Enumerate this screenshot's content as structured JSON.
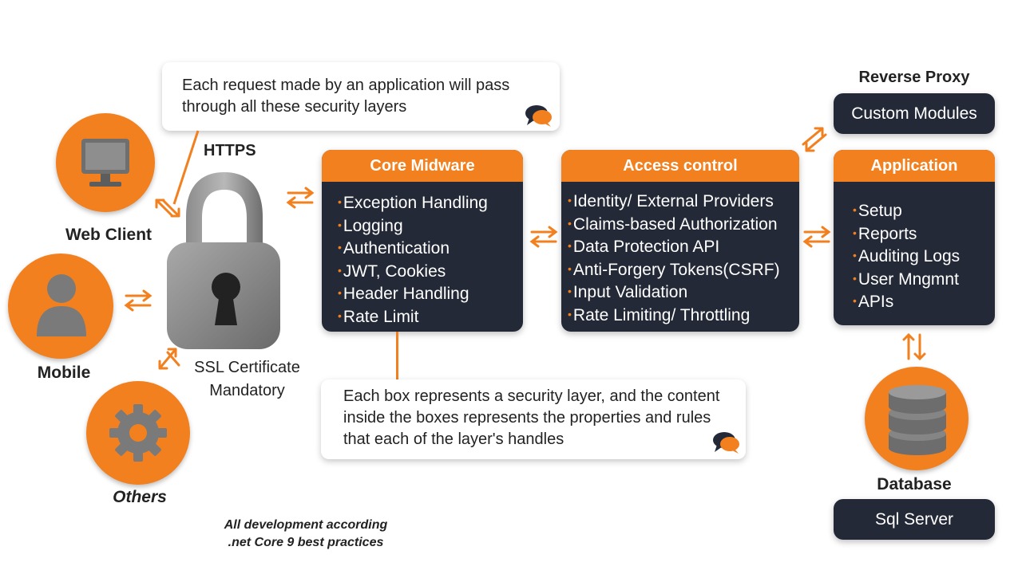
{
  "callout_top": "Each request made by an application will pass through all these security layers",
  "callout_bottom": "Each box represents a security layer, and the content inside the boxes represents the properties and rules that each of the layer's handles",
  "https_label": "HTTPS",
  "ssl_label": "SSL Certificate Mandatory",
  "clients": [
    {
      "label": "Web Client",
      "icon": "monitor-icon"
    },
    {
      "label": "Mobile",
      "icon": "user-icon"
    },
    {
      "label": "Others",
      "icon": "gear-icon"
    }
  ],
  "core_midware": {
    "title": "Core Midware",
    "items": [
      "Exception Handling",
      "Logging",
      "Authentication",
      "JWT, Cookies",
      "Header Handling",
      "Rate Limit"
    ]
  },
  "access_control": {
    "title": "Access control",
    "items": [
      "Identity/ External Providers",
      "Claims-based Authorization",
      "Data Protection API",
      "Anti-Forgery Tokens(CSRF)",
      "Input Validation",
      "Rate Limiting/ Throttling"
    ]
  },
  "application": {
    "title": "Application",
    "items": [
      "Setup",
      "Reports",
      "Auditing Logs",
      "User Mngmnt",
      "APIs"
    ]
  },
  "reverse_proxy": {
    "title": "Reverse Proxy",
    "box": "Custom Modules"
  },
  "database": {
    "title": "Database",
    "box": "Sql Server"
  },
  "footnote": "All development according .net Core 9 best practices",
  "colors": {
    "accent": "#f2801f",
    "dark": "#232937"
  }
}
